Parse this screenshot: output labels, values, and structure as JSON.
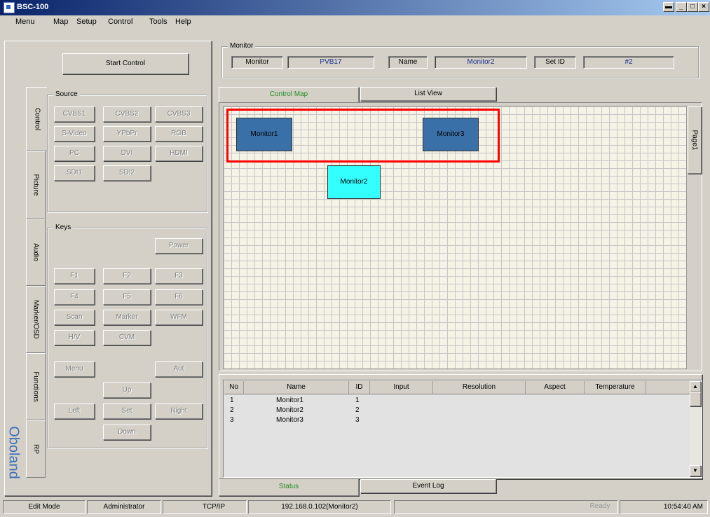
{
  "window": {
    "title": "BSC-100",
    "buttons": [
      "▬",
      "_",
      "□",
      "×"
    ]
  },
  "menu": [
    "Menu",
    "Map",
    "Setup",
    "Control",
    "Tools",
    "Help"
  ],
  "start_control_label": "Start Control",
  "monitor_info": {
    "group_label": "Monitor",
    "monitor_label": "Monitor",
    "monitor_value": "PVB17",
    "name_label": "Name",
    "name_value": "Monitor2",
    "setid_label": "Set ID",
    "setid_value": "#2"
  },
  "side_tabs": [
    "Control",
    "Picture",
    "Audio",
    "Marker/OSD",
    "Functions",
    "RP"
  ],
  "source": {
    "label": "Source",
    "buttons": [
      "CVBS1",
      "CVBS2",
      "CVBS3",
      "S-Video",
      "YPbPr",
      "RGB",
      "PC",
      "DVI",
      "HDMI",
      "SDI1",
      "SDI2"
    ]
  },
  "keys": {
    "label": "Keys",
    "power": "Power",
    "f": [
      "F1",
      "F2",
      "F3",
      "F4",
      "F5",
      "F6"
    ],
    "scan": "Scan",
    "marker": "Marker",
    "wfm": "WFM",
    "hv": "H/V",
    "cvm": "CVM",
    "menu": "Menu",
    "aut": "Aut",
    "up": "Up",
    "left": "Left",
    "set": "Set",
    "right": "Right",
    "down": "Down"
  },
  "logo": "Oboland",
  "map_tabs": {
    "control_map": "Control Map",
    "list_view": "List View"
  },
  "page_tab": "Page1",
  "monitors": [
    {
      "name": "Monitor1",
      "color": "#3a70a8"
    },
    {
      "name": "Monitor3",
      "color": "#3a70a8"
    },
    {
      "name": "Monitor2",
      "color": "#33ffff"
    }
  ],
  "selection_color": "#ff0000",
  "table": {
    "headers": [
      "No",
      "Name",
      "ID",
      "Input",
      "Resolution",
      "Aspect",
      "Temperature"
    ],
    "rows": [
      [
        "1",
        "Monitor1",
        "1"
      ],
      [
        "2",
        "Monitor2",
        "2"
      ],
      [
        "3",
        "Monitor3",
        "3"
      ]
    ]
  },
  "bottom_tabs": {
    "status": "Status",
    "event_log": "Event Log"
  },
  "statusbar": {
    "mode": "Edit Mode",
    "user": "Administrator",
    "protocol": "TCP/IP",
    "address": "192.168.0.102(Monitor2)",
    "ready": "Ready",
    "time": "10:54:40 AM"
  }
}
